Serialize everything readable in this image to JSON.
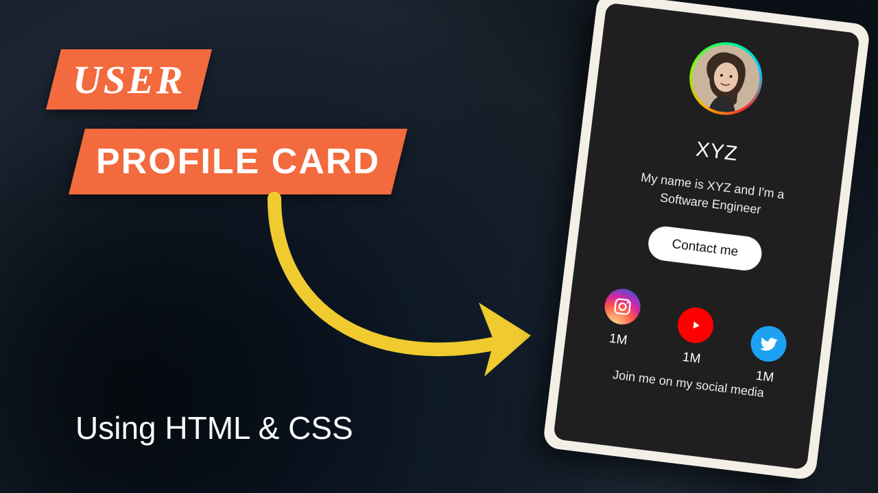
{
  "headline": {
    "ribbon1": "USER",
    "ribbon2": "PROFILE CARD",
    "subtext": "Using HTML & CSS"
  },
  "card": {
    "name": "XYZ",
    "bio": "My name is XYZ and I'm a Software Engineer",
    "contact_label": "Contact me",
    "join_label": "Join me on my social media",
    "socials": [
      {
        "icon": "instagram",
        "count": "1M"
      },
      {
        "icon": "youtube",
        "count": "1M"
      },
      {
        "icon": "twitter",
        "count": "1M"
      }
    ]
  },
  "colors": {
    "accent": "#f26a3d",
    "arrow": "#f0cb2f"
  }
}
